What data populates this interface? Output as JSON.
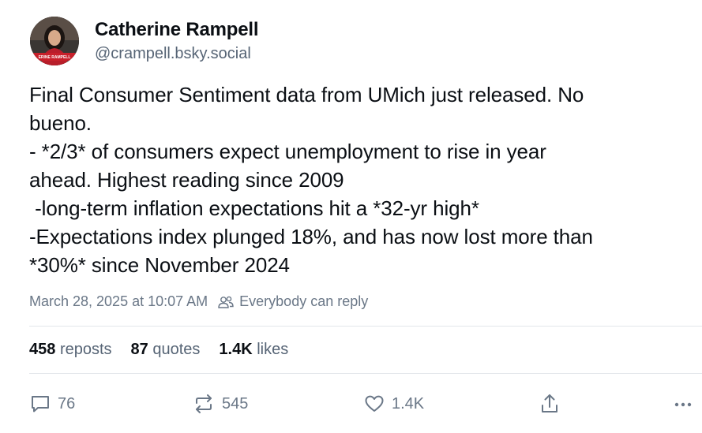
{
  "author": {
    "name": "Catherine Rampell",
    "handle": "@crampell.bsky.social",
    "avatar_caption": "ERINE RAMPELL"
  },
  "post": {
    "lines": [
      "Final Consumer Sentiment data from UMich just released. No",
      "bueno.",
      "- *2/3* of consumers expect unemployment to rise in year",
      "ahead. Highest reading since 2009",
      " -long-term inflation expectations hit a *32-yr high*",
      "-Expectations index plunged 18%, and has now lost more than",
      "*30%* since November 2024"
    ]
  },
  "meta": {
    "timestamp": "March 28, 2025 at 10:07 AM",
    "reply_setting": "Everybody can reply"
  },
  "stats": {
    "reposts_count": "458",
    "reposts_label": "reposts",
    "quotes_count": "87",
    "quotes_label": "quotes",
    "likes_count": "1.4K",
    "likes_label": "likes"
  },
  "actions": {
    "reply_count": "76",
    "repost_count": "545",
    "like_count": "1.4K"
  },
  "icons": {
    "reply": "speech-bubble-icon",
    "repost": "repost-arrows-icon",
    "like": "heart-icon",
    "share": "share-upload-icon",
    "more": "more-dots-icon",
    "reply_setting": "people-icon"
  },
  "colors": {
    "text": "#0b0f14",
    "muted": "#566475",
    "meta": "#6a7787",
    "divider": "#e3e7eb",
    "avatar_banner": "#c8202a"
  }
}
